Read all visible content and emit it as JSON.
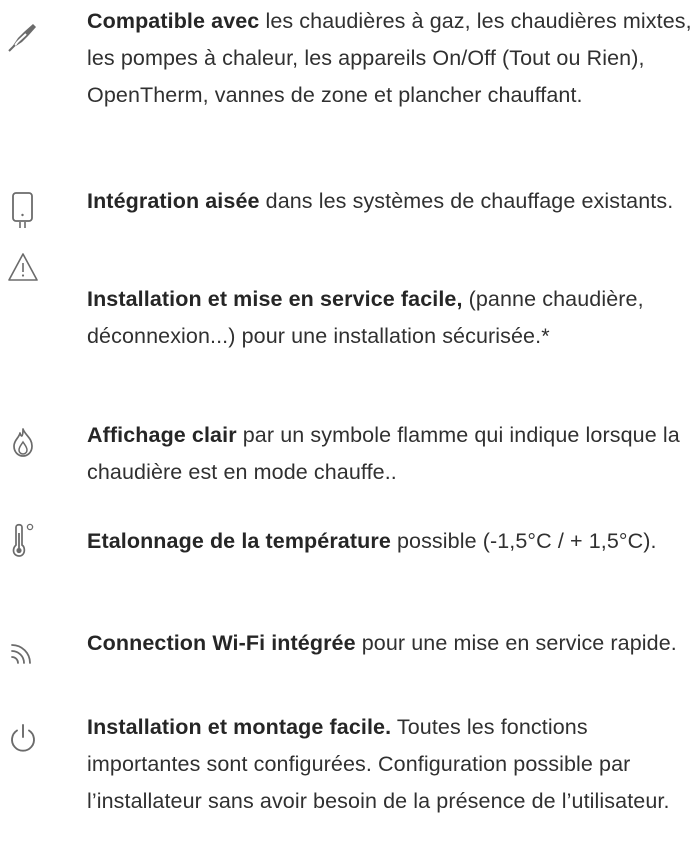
{
  "features": [
    {
      "icon": "pipe-wrench-icon",
      "title": "Compatible avec",
      "body": " les chaudières à gaz, les chaudières mixtes, les pompes à chaleur, les appareils On/Off (Tout ou Rien), OpenTherm, vannes de zone et plancher chauffant."
    },
    {
      "icon": "boiler-icon",
      "title": "Intégration aisée",
      "body": " dans les systèmes de chauffage existants."
    },
    {
      "icon": "warning-triangle-icon",
      "title": "Installation et mise en service facile,",
      "body": " (panne chaudière, déconnexion...) pour une installation sécurisée.*"
    },
    {
      "icon": "flame-icon",
      "title": "Affichage clair",
      "body": " par un symbole flamme qui indique lorsque la chaudière est en mode chauffe.."
    },
    {
      "icon": "thermometer-icon",
      "title": "Etalonnage de la température",
      "body": " possible (-1,5°C / + 1,5°C)."
    },
    {
      "icon": "wifi-icon",
      "title": "Connection Wi-Fi intégrée",
      "body": " pour une mise en service rapide."
    },
    {
      "icon": "power-icon",
      "title": "Installation et montage facile.",
      "body": " Toutes les fonctions importantes sont configurées. Configuration possible par l’installateur sans avoir besoin de la présence de l’utilisateur."
    }
  ],
  "colors": {
    "icon": "#6b6b6b",
    "text": "#303030",
    "title": "#262626"
  }
}
